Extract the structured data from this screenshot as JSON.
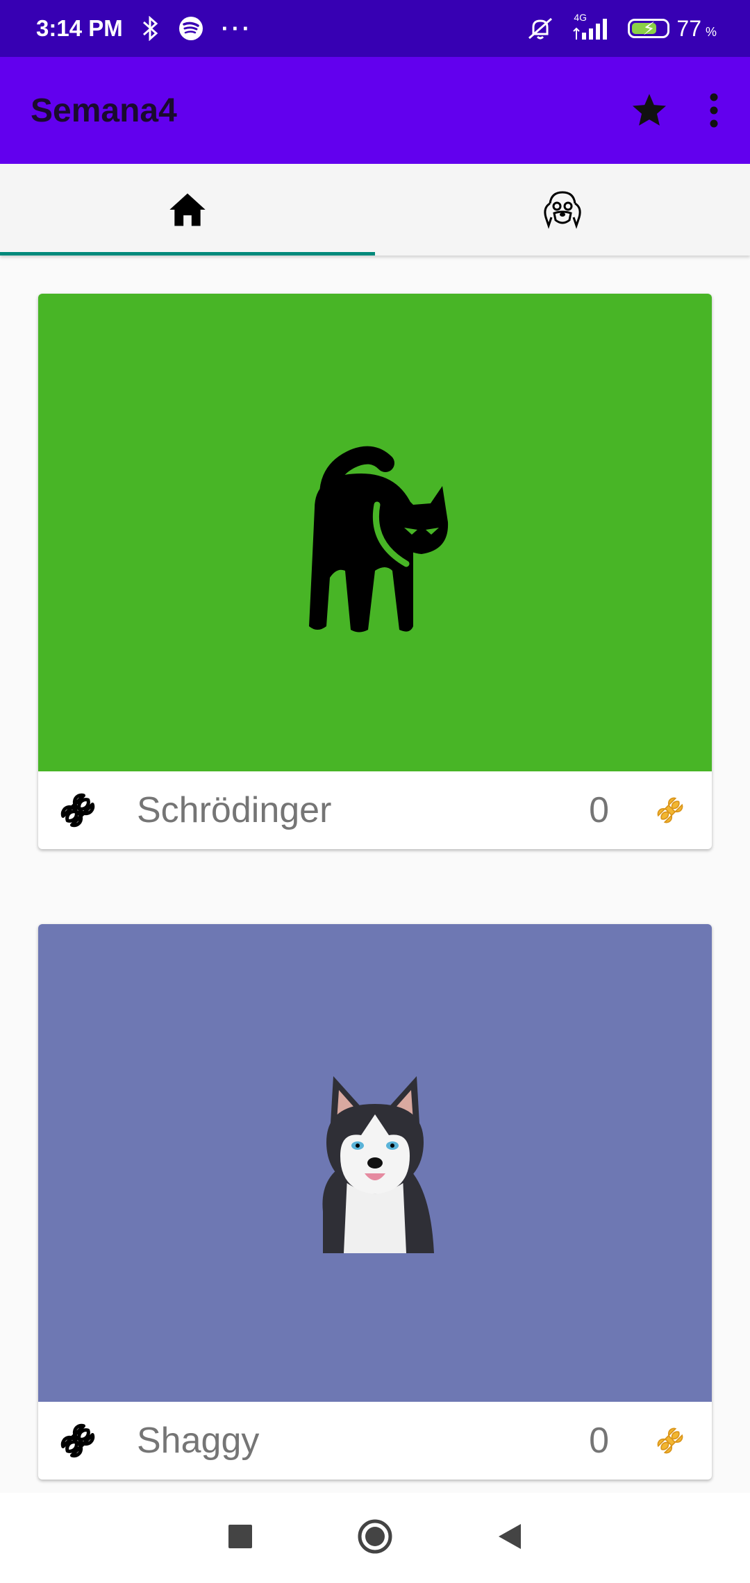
{
  "status_bar": {
    "time": "3:14 PM",
    "dots": "···",
    "network": "4G",
    "battery": "77",
    "battery_unit": "%",
    "icons": [
      "bluetooth-icon",
      "spotify-icon",
      "mute-icon",
      "signal-icon",
      "battery-icon"
    ]
  },
  "app_bar": {
    "title": "Semana4",
    "actions": [
      "star-icon",
      "more-vert-icon"
    ]
  },
  "tabs": [
    {
      "icon": "home-icon",
      "active": true
    },
    {
      "icon": "dog-face-icon",
      "active": false
    }
  ],
  "cards": [
    {
      "name": "Schrödinger",
      "likes": "0",
      "image": "black-cat",
      "background": "#48b526"
    },
    {
      "name": "Shaggy",
      "likes": "0",
      "image": "husky-dog",
      "background": "#6e78b3"
    }
  ],
  "colors": {
    "status_bar": "#3700b3",
    "app_bar": "#6200ee",
    "tab_indicator": "#00897b",
    "bone_gold": "#f2b631"
  },
  "nav_bar": {
    "buttons": [
      "recents-icon",
      "home-circle-icon",
      "back-icon"
    ]
  }
}
